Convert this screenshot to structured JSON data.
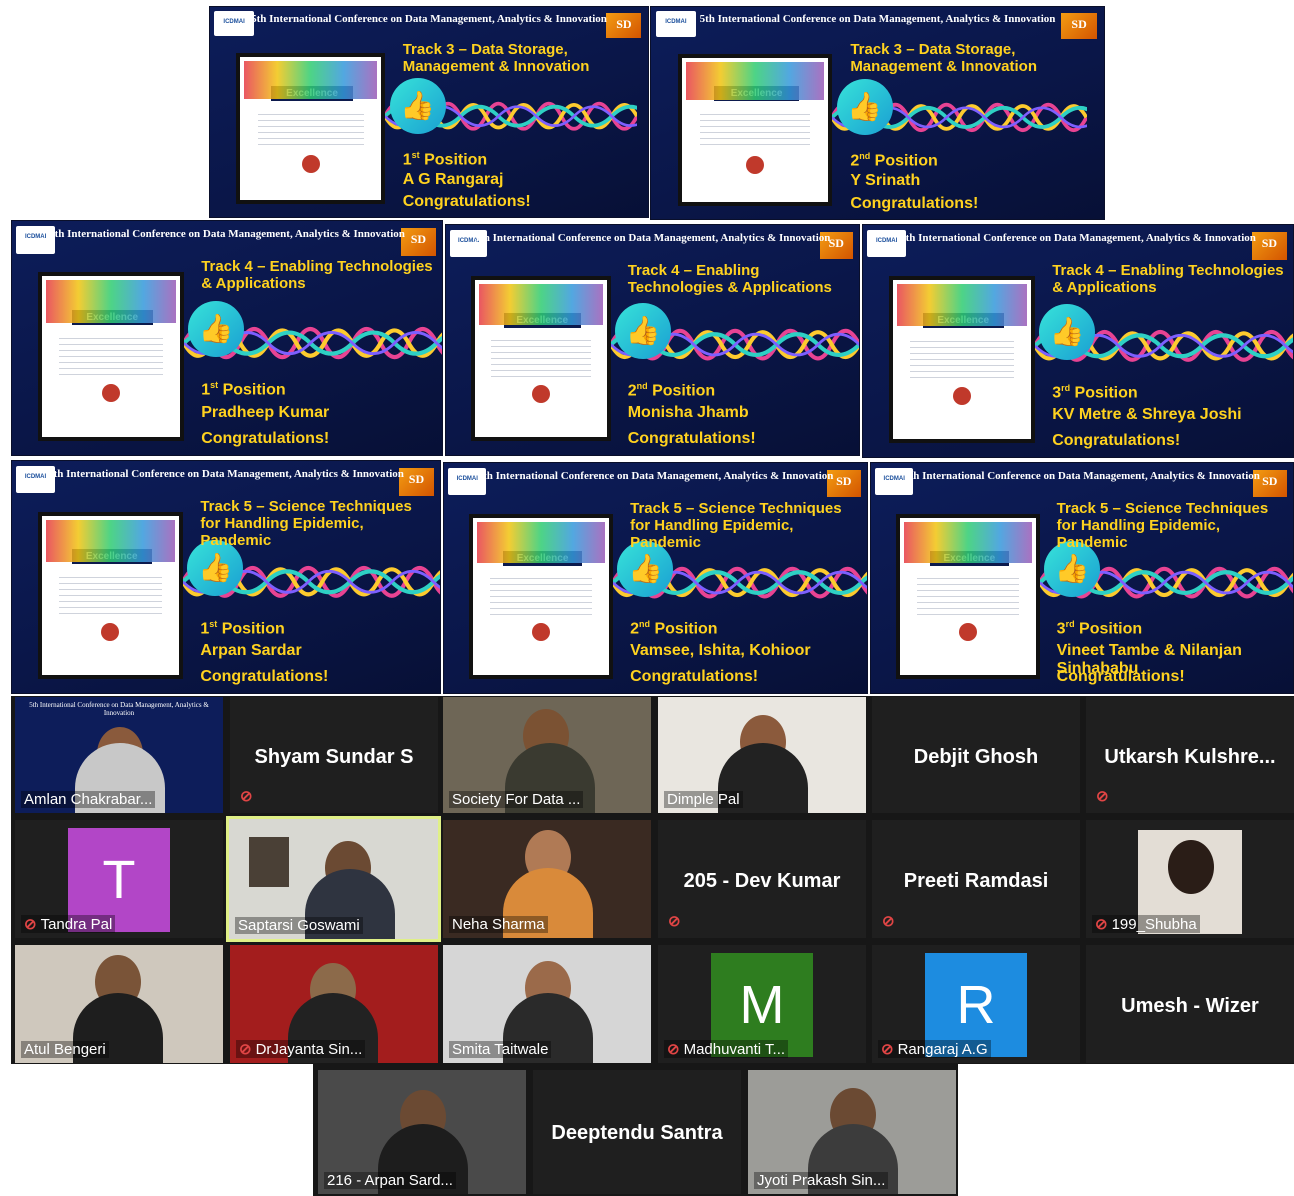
{
  "conference_title": "5th International Conference on Data Management, Analytics & Innovation",
  "certificate_label": "Excellence",
  "congrats": "Congratulations!",
  "slides": [
    {
      "track": "Track 3 – Data Storage, Management & Innovation",
      "rank": "1",
      "suffix": "st",
      "position_word": "Position",
      "winner": "A G Rangaraj"
    },
    {
      "track": "Track 3 – Data Storage, Management & Innovation",
      "rank": "2",
      "suffix": "nd",
      "position_word": "Position",
      "winner": "Y Srinath"
    },
    {
      "track": "Track 4 – Enabling Technologies & Applications",
      "rank": "1",
      "suffix": "st",
      "position_word": "Position",
      "winner": "Pradheep Kumar"
    },
    {
      "track": "Track 4 – Enabling Technologies & Applications",
      "rank": "2",
      "suffix": "nd",
      "position_word": "Position",
      "winner": "Monisha Jhamb"
    },
    {
      "track": "Track 4 – Enabling Technologies & Applications",
      "rank": "3",
      "suffix": "rd",
      "position_word": "Position",
      "winner": "KV Metre & Shreya Joshi"
    },
    {
      "track": "Track 5 – Science Techniques for Handling Epidemic, Pandemic",
      "rank": "1",
      "suffix": "st",
      "position_word": "Position",
      "winner": "Arpan Sardar"
    },
    {
      "track": "Track 5 – Science Techniques for Handling Epidemic, Pandemic",
      "rank": "2",
      "suffix": "nd",
      "position_word": "Position",
      "winner": "Vamsee, Ishita, Kohioor"
    },
    {
      "track": "Track 5 – Science Techniques for Handling Epidemic, Pandemic",
      "rank": "3",
      "suffix": "rd",
      "position_word": "Position",
      "winner": "Vineet Tambe & Nilanjan Sinhababu"
    }
  ],
  "participants": {
    "amlan": "Amlan Chakrabar...",
    "shyam": "Shyam Sundar S",
    "society": "Society For Data ...",
    "dimple": "Dimple Pal",
    "debjit": "Debjit Ghosh",
    "utkarsh": "Utkarsh  Kulshre...",
    "tandra": "Tandra Pal",
    "tandra_initial": "T",
    "saptarsi": "Saptarsi Goswami",
    "neha": "Neha Sharma",
    "dev": "205 - Dev Kumar",
    "preeti": "Preeti Ramdasi",
    "shubha": "199_Shubha",
    "atul": "Atul Bengeri",
    "jayanta": "DrJayanta Sin...",
    "smita": "Smita Taitwale",
    "madhuvanti": "Madhuvanti T...",
    "madhuvanti_initial": "M",
    "rangaraj": "Rangaraj A.G",
    "rangaraj_initial": "R",
    "umesh": "Umesh - Wizer",
    "arpan": "216 - Arpan Sard...",
    "deeptendu": "Deeptendu Santra",
    "jyoti": "Jyoti Prakash Sin..."
  },
  "colors": {
    "slide_bg": "#0d1d5a",
    "accent_yellow": "#ffd21f",
    "tile_bg": "#1f1f1f",
    "active_border": "#e0f087",
    "mute_red": "#e04545",
    "avatar_purple": "#b246c7",
    "avatar_green": "#2e7d1f",
    "avatar_blue": "#1d8ce0"
  },
  "icons": [
    "thumbs-up-icon",
    "mic-muted-icon",
    "conference-logo-icon",
    "sponsor-logo-icon"
  ]
}
